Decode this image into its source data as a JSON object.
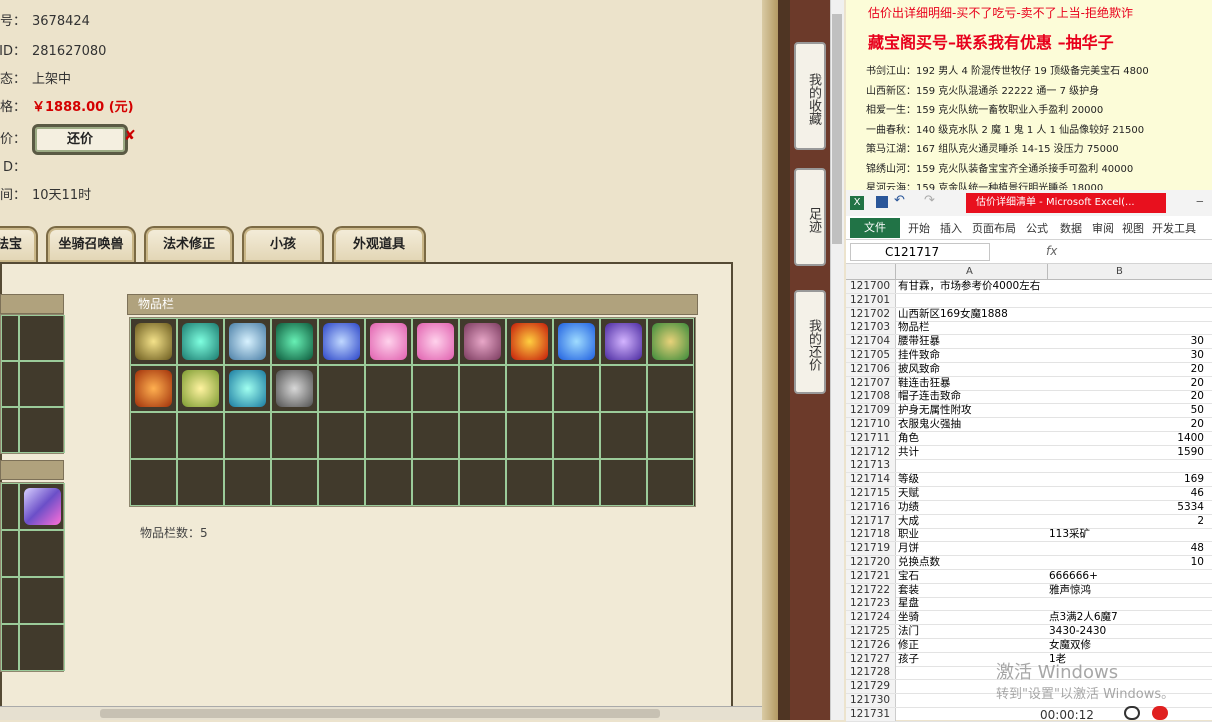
{
  "listing": {
    "rows": [
      {
        "label": "号：",
        "value": "3678424"
      },
      {
        "label": "ID：",
        "value": "281627080"
      },
      {
        "label": "态：",
        "value": "上架中"
      },
      {
        "label": "格：",
        "value": "￥1888.00 (元)"
      },
      {
        "label": "还价：",
        "value": ""
      },
      {
        "label": "D：",
        "value": ""
      },
      {
        "label": "间：",
        "value": "10天11时"
      }
    ],
    "counter_button": "还价"
  },
  "tabs": [
    "法宝",
    "坐骑召唤兽",
    "法术修正",
    "小孩",
    "外观道具"
  ],
  "inventory": {
    "header": "物品栏",
    "count_label": "物品栏数：5"
  },
  "sidebar_tabs": [
    "我的收藏",
    "足迹",
    "我的还价"
  ],
  "doc": {
    "heading1": "估价出详细明细-买不了吃亏-卖不了上当-拒绝欺诈",
    "heading2": "藏宝阁买号–联系我有优惠 –抽华子",
    "lines": [
      "书剑江山：192 男人 4 阶混传世牧仔 19 顶级备完美宝石 4800",
      "山西新区：159 克火队混通杀 22222 通一 7 级护身",
      "相爱一生：159 克火队统一畜牧职业入手盈利 20000",
      "一曲春秋：140 级克水队 2 魔 1 鬼 1 人 1 仙品像较好 21500",
      "策马江湖：167 组队克火通灵睡杀 14-15 没压力 75000",
      "锦绣山河：159 克火队装备宝宝齐全通杀接手可盈利 40000",
      "星河云海：159 克金队统一种植景行明光睡杀 18000"
    ]
  },
  "excel": {
    "title": "估价详细清单 - Microsoft Excel(...",
    "file_tab": "文件",
    "ribbon_tabs": [
      "开始",
      "插入",
      "页面布局",
      "公式",
      "数据",
      "审阅",
      "视图",
      "开发工具"
    ],
    "namebox": "C121717",
    "fx": "fx",
    "col_a": "A",
    "col_b": "B",
    "rows": [
      {
        "n": "121700",
        "a": "有甘霖，市场参考价4000左右",
        "b": ""
      },
      {
        "n": "121701",
        "a": "",
        "b": ""
      },
      {
        "n": "121702",
        "a": "山西新区169女魔1888",
        "b": ""
      },
      {
        "n": "121703",
        "a": "物品栏",
        "b": ""
      },
      {
        "n": "121704",
        "a": "腰带狂暴",
        "b": "30"
      },
      {
        "n": "121705",
        "a": "挂件致命",
        "b": "30"
      },
      {
        "n": "121706",
        "a": "披风致命",
        "b": "20"
      },
      {
        "n": "121707",
        "a": "鞋连击狂暴",
        "b": "20"
      },
      {
        "n": "121708",
        "a": "帽子连击致命",
        "b": "20"
      },
      {
        "n": "121709",
        "a": "护身无属性附攻",
        "b": "50"
      },
      {
        "n": "121710",
        "a": "衣服鬼火强抽",
        "b": "20"
      },
      {
        "n": "121711",
        "a": "角色",
        "b": "1400"
      },
      {
        "n": "121712",
        "a": "共计",
        "b": "1590"
      },
      {
        "n": "121713",
        "a": "",
        "b": ""
      },
      {
        "n": "121714",
        "a": "等级",
        "b": "169"
      },
      {
        "n": "121715",
        "a": "天赋",
        "b": "46"
      },
      {
        "n": "121716",
        "a": "功绩",
        "b": "5334"
      },
      {
        "n": "121717",
        "a": "大成",
        "b": "2"
      },
      {
        "n": "121718",
        "a": "职业",
        "b": "113采矿"
      },
      {
        "n": "121719",
        "a": "月饼",
        "b": "48"
      },
      {
        "n": "121720",
        "a": "兑换点数",
        "b": "10"
      },
      {
        "n": "121721",
        "a": "宝石",
        "b": "666666+"
      },
      {
        "n": "121722",
        "a": "套装",
        "b": "雅声惊鸿"
      },
      {
        "n": "121723",
        "a": "星盘",
        "b": ""
      },
      {
        "n": "121724",
        "a": "坐骑",
        "b": "点3满2人6魔7"
      },
      {
        "n": "121725",
        "a": "法门",
        "b": "3430-2430"
      },
      {
        "n": "121726",
        "a": "修正",
        "b": "女魔双修"
      },
      {
        "n": "121727",
        "a": "孩子",
        "b": "1老"
      },
      {
        "n": "121728",
        "a": "",
        "b": ""
      },
      {
        "n": "121729",
        "a": "",
        "b": ""
      },
      {
        "n": "121730",
        "a": "",
        "b": ""
      },
      {
        "n": "121731",
        "a": "",
        "b": ""
      }
    ]
  },
  "watermark": {
    "line1": "激活 Windows",
    "line2": "转到\"设置\"以激活 Windows。"
  },
  "timer": "00:00:12"
}
